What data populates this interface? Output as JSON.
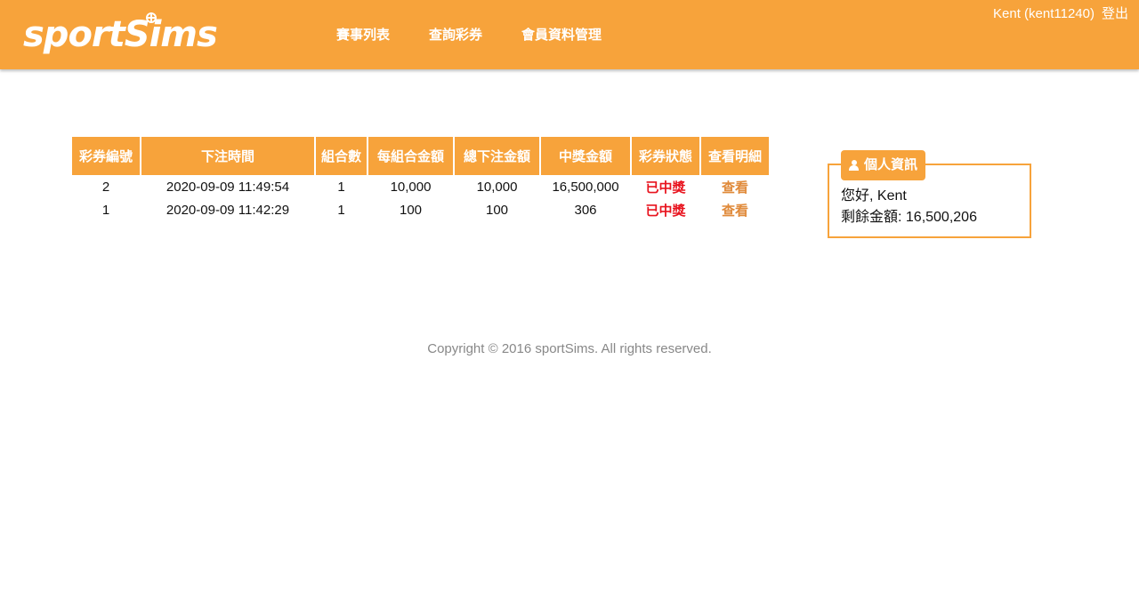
{
  "brand": {
    "logo_text": "sportSims",
    "color": "#f7a33b"
  },
  "nav": [
    {
      "label": "賽事列表"
    },
    {
      "label": "查詢彩券"
    },
    {
      "label": "會員資料管理"
    }
  ],
  "user": {
    "display": "Kent (kent11240)",
    "logout_label": "登出"
  },
  "tickets": {
    "columns": [
      "彩券編號",
      "下注時間",
      "組合數",
      "每組合金額",
      "總下注金額",
      "中獎金額",
      "彩券狀態",
      "查看明細"
    ],
    "rows": [
      {
        "id": "2",
        "time": "2020-09-09 11:49:54",
        "combos": "1",
        "per_combo": "10,000",
        "total": "10,000",
        "prize": "16,500,000",
        "status": "已中獎",
        "view": "查看"
      },
      {
        "id": "1",
        "time": "2020-09-09 11:42:29",
        "combos": "1",
        "per_combo": "100",
        "total": "100",
        "prize": "306",
        "status": "已中獎",
        "view": "查看"
      }
    ],
    "status_color": "#e8141f"
  },
  "profile": {
    "title": "個人資訊",
    "icon": "person-icon",
    "greeting": "您好, Kent",
    "balance": "剩餘金額: 16,500,206"
  },
  "footer": {
    "text": "Copyright © 2016 sportSims. All rights reserved."
  }
}
